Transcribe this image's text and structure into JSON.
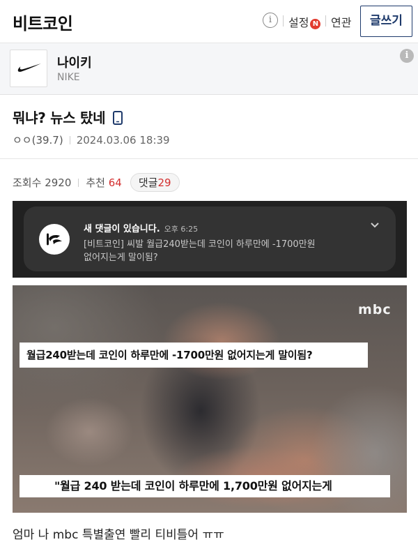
{
  "header": {
    "board_title": "비트코인",
    "info_icon": "info-circle-icon",
    "settings_label": "설정",
    "settings_badge": "N",
    "related_label": "연관",
    "write_button": "글쓰기"
  },
  "gallery": {
    "logo_icon": "nike-swoosh-icon",
    "name": "나이키",
    "subtitle": "NIKE"
  },
  "post": {
    "title": "뭐냐? 뉴스 탔네",
    "device_icon": "mobile-phone-icon",
    "author": "ㅇㅇ(39.7)",
    "date": "2024.03.06 18:39",
    "views_label": "조회수",
    "views_value": "2920",
    "recommend_label": "추천",
    "recommend_value": "64",
    "comments_label": "댓글",
    "comments_value": "29",
    "body": "엄마 나 mbc 특별출연 빨리 티비틀어 ㅠㅠ"
  },
  "notification": {
    "title": "새 댓글이 있습니다.",
    "time": "오후 6:25",
    "line1": "[비트코인] 씨발 월급240받는데 코인이 하루만에 -1700만원",
    "line2": "없어지는게 말이됨?"
  },
  "video": {
    "channel_logo": "mbc",
    "caption_top": "월급240받는데 코인이 하루만에 -1700만원 없어지는게 말이됨?",
    "caption_bottom": "\"월급 240 받는데 코인이 하루만에 1,700만원 없어지는게"
  },
  "colors": {
    "accent_navy": "#1e3a6b",
    "highlight_red": "#d32f2f",
    "badge_red": "#e23b2f"
  }
}
